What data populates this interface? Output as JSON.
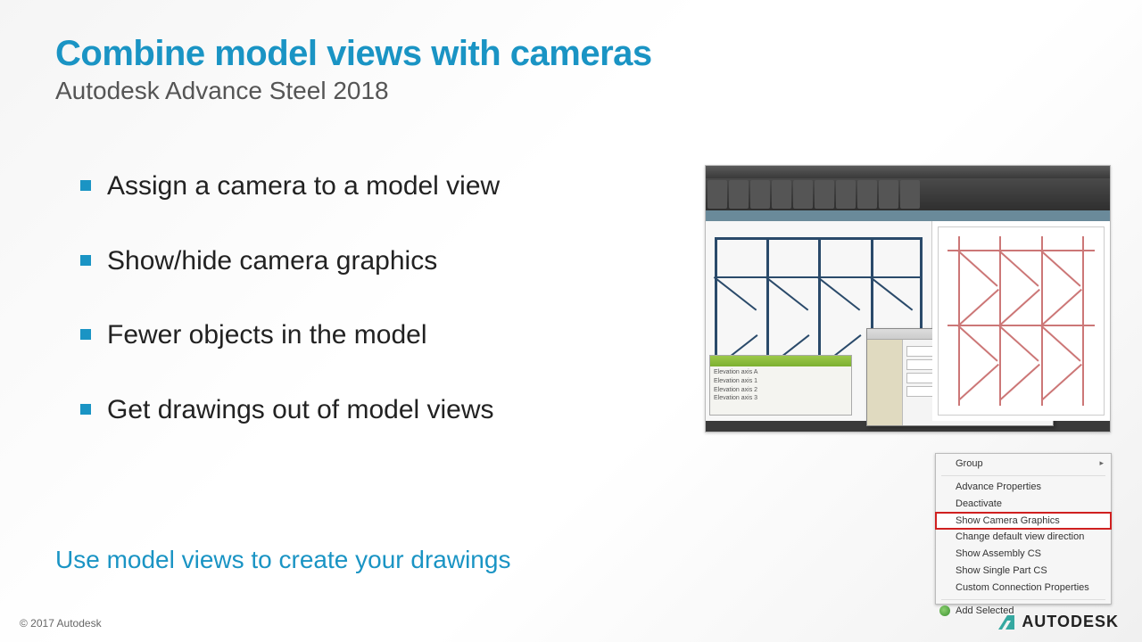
{
  "title": "Combine model views with cameras",
  "subtitle": "Autodesk Advance Steel 2018",
  "bullets": [
    "Assign a camera to a model view",
    "Show/hide camera graphics",
    "Fewer objects in the model",
    "Get drawings out of model views"
  ],
  "footer_line": "Use model views to create your drawings",
  "copyright": "© 2017 Autodesk",
  "logo_text": "AUTODESK",
  "context_menu": {
    "items": [
      {
        "label": "Group",
        "arrow": true
      },
      {
        "sep": true
      },
      {
        "label": "Advance Properties"
      },
      {
        "label": "Deactivate"
      },
      {
        "label": "Show Camera Graphics",
        "highlight": true
      },
      {
        "label": "Change default view direction"
      },
      {
        "label": "Show Assembly CS"
      },
      {
        "label": "Show Single Part CS"
      },
      {
        "label": "Custom Connection Properties"
      },
      {
        "sep": true
      },
      {
        "label": "Add Selected",
        "addsel": true
      }
    ]
  },
  "panel_items": [
    "Elevation axis A",
    "Elevation axis 1",
    "Elevation axis 2",
    "Elevation axis 3"
  ]
}
